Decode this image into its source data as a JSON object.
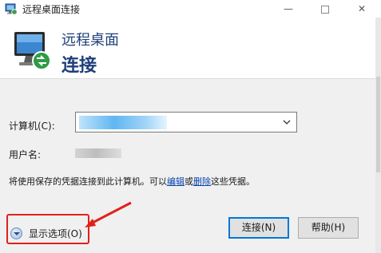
{
  "window": {
    "title": "远程桌面连接",
    "minimize_glyph": "—",
    "close_glyph": "✕"
  },
  "header": {
    "title_line1": "远程桌面",
    "title_line2": "连接"
  },
  "form": {
    "computer_label": "计算机(C):",
    "computer_value_state": "blurred",
    "username_label": "用户名:",
    "username_value_state": "blurred"
  },
  "note": {
    "prefix": "将使用保存的凭据连接到此计算机。可以",
    "link_edit": "编辑",
    "middle": "或",
    "link_delete": "删除",
    "suffix": "这些凭据。"
  },
  "options": {
    "label": "显示选项(O)"
  },
  "buttons": {
    "connect": "连接(N)",
    "help": "帮助(H)"
  },
  "annotation": {
    "color": "#e0201b"
  },
  "icons": {
    "title": "remote-desktop-icon",
    "header": "monitor-connection-icon",
    "combo_arrow": "chevron-down-icon",
    "options": "expand-down-icon"
  },
  "colors": {
    "header_text": "#1f3f7a",
    "link": "#0645ad",
    "default_button_border": "#0078d7"
  }
}
